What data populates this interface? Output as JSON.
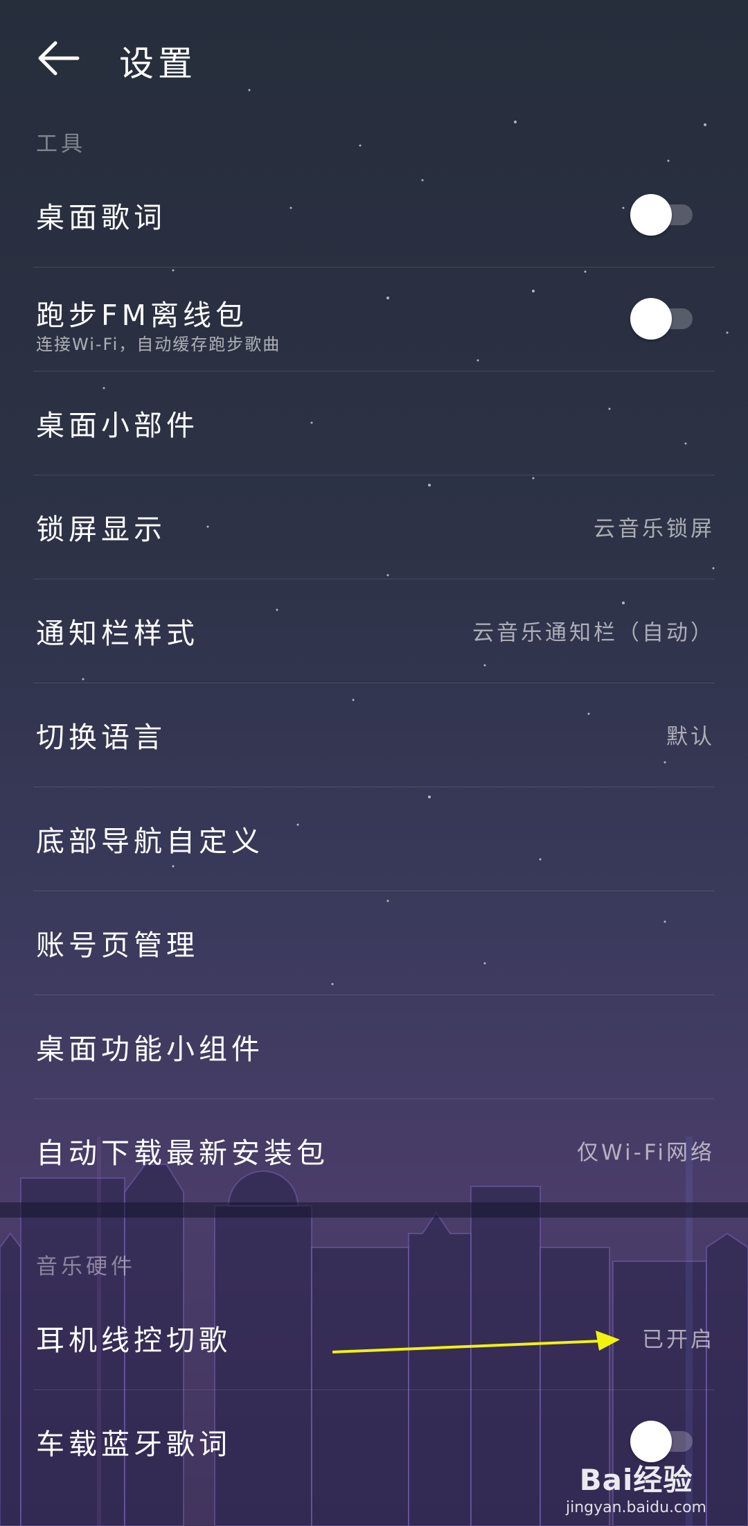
{
  "header": {
    "title": "设置"
  },
  "sections": [
    {
      "title": "工具"
    },
    {
      "title": "音乐硬件"
    }
  ],
  "items": [
    {
      "label": "桌面歌词",
      "toggle": false
    },
    {
      "label": "跑步FM离线包",
      "sub": "连接Wi-Fi，自动缓存跑步歌曲",
      "toggle": false
    },
    {
      "label": "桌面小部件"
    },
    {
      "label": "锁屏显示",
      "value": "云音乐锁屏"
    },
    {
      "label": "通知栏样式",
      "value": "云音乐通知栏（自动）"
    },
    {
      "label": "切换语言",
      "value": "默认"
    },
    {
      "label": "底部导航自定义"
    },
    {
      "label": "账号页管理"
    },
    {
      "label": "桌面功能小组件"
    },
    {
      "label": "自动下载最新安装包",
      "value": "仅Wi-Fi网络"
    },
    {
      "label": "耳机线控切歌",
      "value": "已开启"
    },
    {
      "label": "车载蓝牙歌词",
      "toggle": false
    }
  ],
  "annotation": {
    "arrow_color": "#f2f20f"
  },
  "watermark": {
    "logo": "Bai经验",
    "url": "jingyan.baidu.com"
  },
  "colors": {
    "bg_top": "#262d3b",
    "bg_bottom": "#4b3d6a",
    "text": "#ffffff"
  }
}
